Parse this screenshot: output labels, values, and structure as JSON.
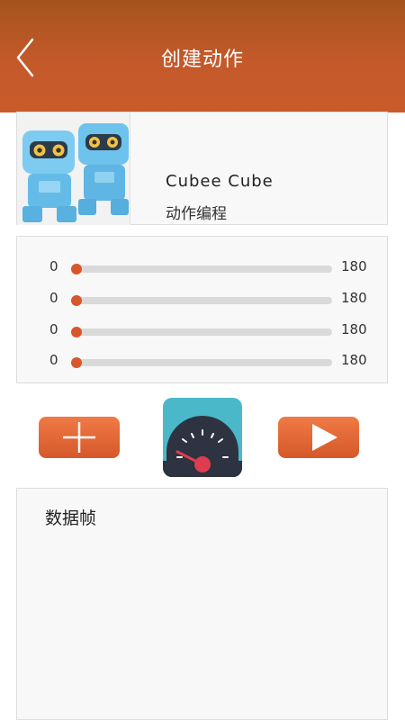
{
  "header": {
    "title": "创建动作",
    "bg_color": "#c4592a"
  },
  "robot": {
    "name": "Cubee Cube",
    "subtitle": "动作编程"
  },
  "sliders": [
    {
      "min_label": "0",
      "max_label": "180",
      "value": 0
    },
    {
      "min_label": "0",
      "max_label": "180",
      "value": 0
    },
    {
      "min_label": "0",
      "max_label": "180",
      "value": 0
    },
    {
      "min_label": "0",
      "max_label": "180",
      "value": 0
    }
  ],
  "controls": {
    "add_icon": "plus-icon",
    "speed_icon": "speedometer-icon",
    "play_icon": "play-icon",
    "accent_color": "#d8562b"
  },
  "frames": {
    "title": "数据帧"
  }
}
